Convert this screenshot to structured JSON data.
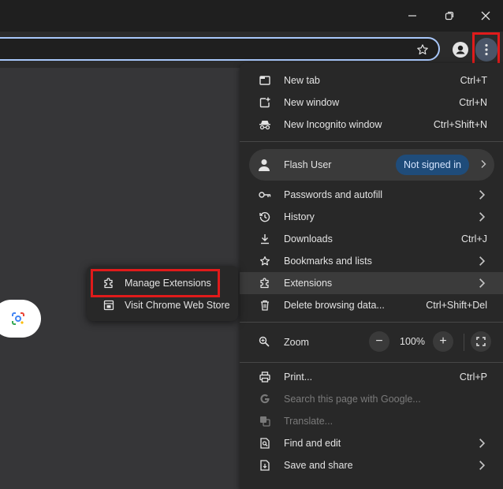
{
  "window": {
    "minimize_icon": "minimize-icon",
    "restore_icon": "restore-icon",
    "close_icon": "close-icon"
  },
  "toolbar": {
    "bookmark_icon": "star-icon",
    "profile_icon": "person-icon",
    "menu_icon": "kebab-icon"
  },
  "menu": {
    "new_tab": {
      "label": "New tab",
      "shortcut": "Ctrl+T"
    },
    "new_window": {
      "label": "New window",
      "shortcut": "Ctrl+N"
    },
    "new_incognito": {
      "label": "New Incognito window",
      "shortcut": "Ctrl+Shift+N"
    },
    "profile": {
      "name": "Flash User",
      "status": "Not signed in"
    },
    "passwords": {
      "label": "Passwords and autofill"
    },
    "history": {
      "label": "History"
    },
    "downloads": {
      "label": "Downloads",
      "shortcut": "Ctrl+J"
    },
    "bookmarks": {
      "label": "Bookmarks and lists"
    },
    "extensions": {
      "label": "Extensions"
    },
    "delete_data": {
      "label": "Delete browsing data...",
      "shortcut": "Ctrl+Shift+Del"
    },
    "zoom": {
      "label": "Zoom",
      "minus": "−",
      "value": "100%",
      "plus": "+"
    },
    "print": {
      "label": "Print...",
      "shortcut": "Ctrl+P"
    },
    "search_google": {
      "label": "Search this page with Google..."
    },
    "translate": {
      "label": "Translate..."
    },
    "find_edit": {
      "label": "Find and edit"
    },
    "save_share": {
      "label": "Save and share"
    }
  },
  "submenu": {
    "manage_extensions": {
      "label": "Manage Extensions"
    },
    "web_store": {
      "label": "Visit Chrome Web Store"
    }
  },
  "colors": {
    "highlight": "#e01b1b",
    "accent": "#a8c7fa",
    "menu_bg": "#282828"
  }
}
